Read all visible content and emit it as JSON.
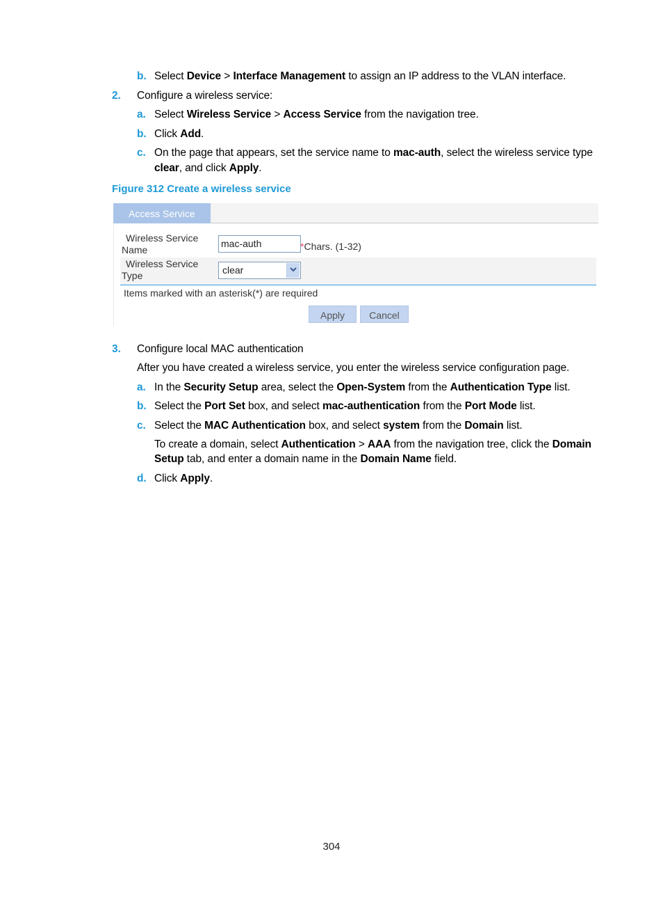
{
  "steps": {
    "pre_b": {
      "marker": "b.",
      "parts": [
        "Select ",
        "Device",
        " > ",
        "Interface Management",
        " to assign an IP address to the VLAN interface."
      ]
    },
    "step2": {
      "marker": "2.",
      "text": "Configure a wireless service:"
    },
    "step2a": {
      "marker": "a.",
      "parts": [
        "Select ",
        "Wireless Service",
        " > ",
        "Access Service",
        " from the navigation tree."
      ]
    },
    "step2b": {
      "marker": "b.",
      "parts": [
        "Click ",
        "Add",
        "."
      ]
    },
    "step2c": {
      "marker": "c.",
      "line1": [
        "On the page that appears, set the service name to ",
        "mac-auth",
        ", select the wireless service type"
      ],
      "line2": [
        "clear",
        ", and click ",
        "Apply",
        "."
      ]
    },
    "step3": {
      "marker": "3.",
      "text": "Configure local MAC authentication"
    },
    "step3_intro": "After you have created a wireless service, you enter the wireless service configuration page.",
    "step3a": {
      "marker": "a.",
      "parts": [
        "In the ",
        "Security Setup",
        " area, select the ",
        "Open-System",
        " from the ",
        "Authentication Type",
        " list."
      ]
    },
    "step3b": {
      "marker": "b.",
      "parts": [
        "Select the ",
        "Port Set",
        " box, and select ",
        "mac-authentication",
        " from the ",
        "Port Mode",
        " list."
      ]
    },
    "step3c": {
      "marker": "c.",
      "parts": [
        "Select the ",
        "MAC Authentication",
        " box, and select ",
        "system",
        " from the ",
        "Domain",
        " list."
      ]
    },
    "step3c_note": {
      "line1": [
        "To create a domain, select ",
        "Authentication",
        " > ",
        "AAA",
        " from the navigation tree, click the ",
        "Domain"
      ],
      "line2": [
        "Setup",
        " tab, and enter a domain name in the ",
        "Domain Name",
        " field."
      ]
    },
    "step3d": {
      "marker": "d.",
      "parts": [
        "Click ",
        "Apply",
        "."
      ]
    }
  },
  "figure": {
    "caption": "Figure 312 Create a wireless service",
    "tab_label": "Access Service",
    "name_label_1": "Wireless Service",
    "name_label_2": "Name",
    "name_value": "mac-auth",
    "name_hint_star": "*",
    "name_hint": "Chars. (1-32)",
    "type_label_1": "Wireless Service",
    "type_label_2": "Type",
    "type_value": "clear",
    "required_note": "Items marked with an asterisk(*) are required",
    "apply_label": "Apply",
    "cancel_label": "Cancel"
  },
  "page_number": "304",
  "colors": {
    "accent": "#1f9ad6",
    "tab": "#a9c4e8",
    "button": "#c3d5f0",
    "divider": "#2f9fe0"
  }
}
